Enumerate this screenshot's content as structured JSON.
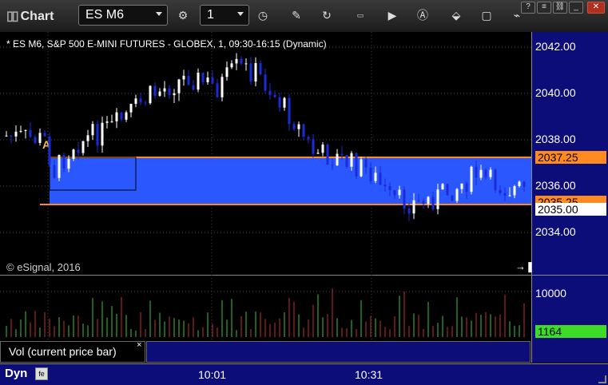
{
  "toolbar": {
    "title": "Chart",
    "symbol": "ES M6",
    "interval": "1"
  },
  "chart": {
    "title": "* ES M6, S&P 500 E-MINI FUTURES - GLOBEX, 1, 09:30-16:15 (Dynamic)",
    "copyright": "© eSignal, 2016",
    "annotation": "A",
    "price_ticks": [
      "2042.00",
      "2040.00",
      "2038.00",
      "2036.00",
      "2034.00"
    ],
    "upper_level_tag": "2037.25",
    "lower_level_tag": "2035.25",
    "last_price_tag": "2035.00",
    "volume_tick": "10000",
    "last_volume_tag": "1164",
    "volume_study_label": "Vol (current price bar)",
    "time_ticks": [
      "10:01",
      "10:31"
    ],
    "mode_label": "Dyn"
  },
  "colors": {
    "band": "#2b57ff",
    "level_line": "#ff8a1f",
    "up_candle": "#ffffff",
    "down_candle": "#1a2bd8",
    "vol_up": "#3fbf3f",
    "vol_down": "#c03030",
    "axis_bg": "#0d0d7a",
    "volume_tag": "#3cdc28",
    "price_tag": "#ffffff"
  }
}
